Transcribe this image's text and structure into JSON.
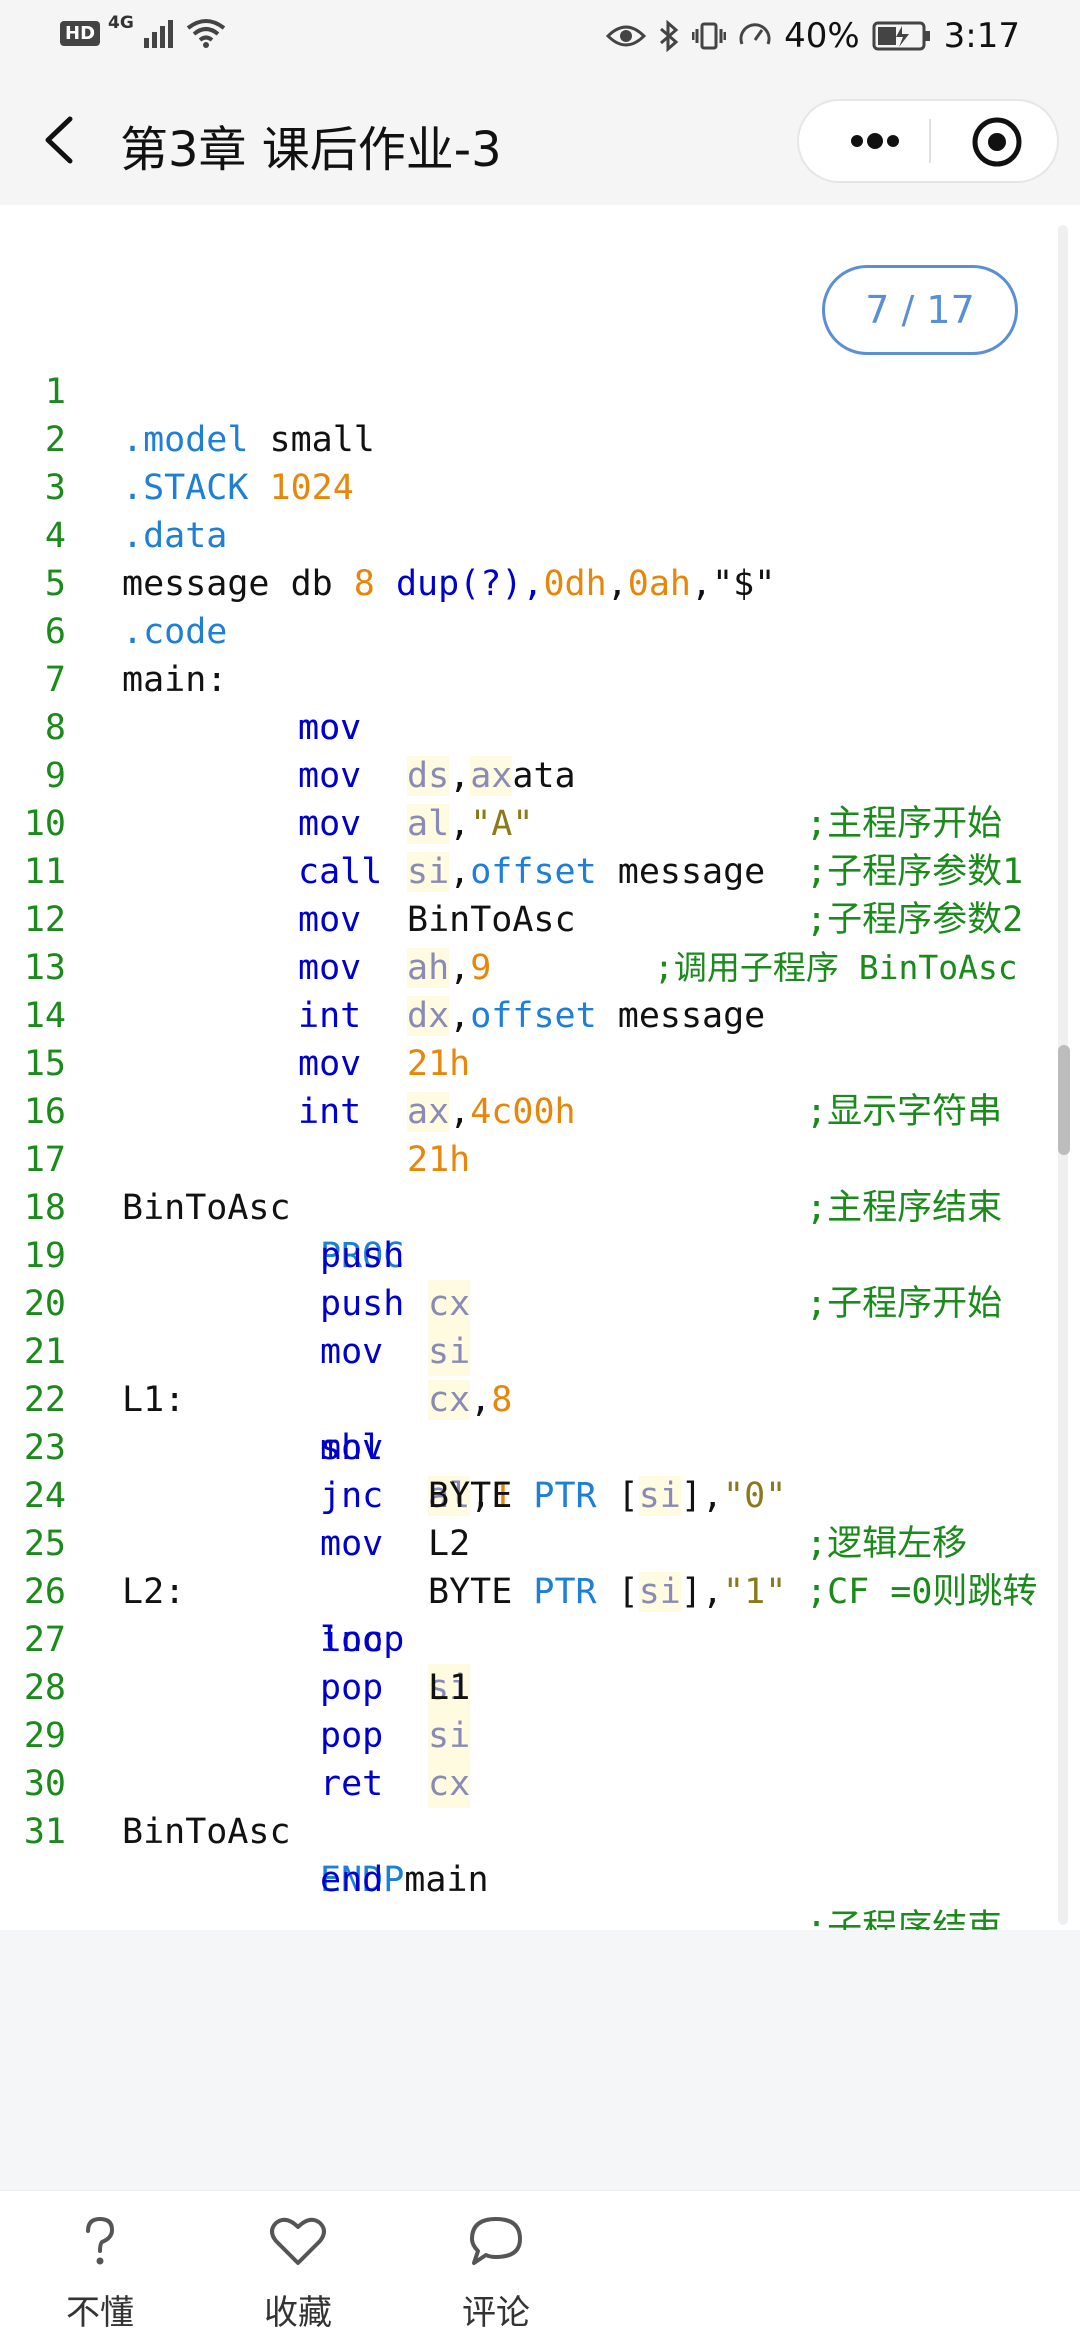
{
  "status_bar": {
    "hd": "HD",
    "network": "4G",
    "battery_percent": "40%",
    "time": "3:17"
  },
  "header": {
    "title": "第3章 课后作业-3"
  },
  "pager": {
    "text": "7 / 17"
  },
  "code_lines": [
    {
      "n": "1"
    },
    {
      "n": "2"
    },
    {
      "n": "3"
    },
    {
      "n": "4"
    },
    {
      "n": "5"
    },
    {
      "n": "6"
    },
    {
      "n": "7"
    },
    {
      "n": "8"
    },
    {
      "n": "9"
    },
    {
      "n": "10"
    },
    {
      "n": "11"
    },
    {
      "n": "12"
    },
    {
      "n": "13"
    },
    {
      "n": "14"
    },
    {
      "n": "15"
    },
    {
      "n": "16"
    },
    {
      "n": "17"
    },
    {
      "n": "18"
    },
    {
      "n": "19"
    },
    {
      "n": "20"
    },
    {
      "n": "21"
    },
    {
      "n": "22"
    },
    {
      "n": "23"
    },
    {
      "n": "24"
    },
    {
      "n": "25"
    },
    {
      "n": "26"
    },
    {
      "n": "27"
    },
    {
      "n": "28"
    },
    {
      "n": "29"
    },
    {
      "n": "30"
    },
    {
      "n": "31"
    }
  ],
  "code": {
    "l1": [
      ".model",
      " small"
    ],
    "l2": [
      ".STACK",
      " 1024"
    ],
    "l3": [
      ".data"
    ],
    "l4": [
      "message db ",
      "8",
      " ",
      "dup",
      "(?),",
      "0dh",
      ",",
      "0ah",
      ",",
      "\"$\""
    ],
    "l5": [
      ".code"
    ],
    "l6": [
      "main:",
      "mov",
      "ax",
      ",@data",
      ";主程序开始"
    ],
    "l7": [
      "mov",
      "ds",
      ",",
      "ax"
    ],
    "l8": [
      "mov",
      "al",
      ",",
      "\"A\"",
      ";子程序参数1"
    ],
    "l9": [
      "mov",
      "si",
      ",",
      "offset",
      " message",
      ";子程序参数2"
    ],
    "l10": [
      "call",
      "BinToAsc",
      ";调用子程序 BinToAsc"
    ],
    "l11": [
      "mov",
      "ah",
      ",",
      "9"
    ],
    "l12": [
      "mov",
      "dx",
      ",",
      "offset",
      " message"
    ],
    "l13": [
      "int",
      "21h",
      ";显示字符串"
    ],
    "l14": [
      "mov",
      "ax",
      ",",
      "4c00h"
    ],
    "l15": [
      "int",
      "21h",
      ";主程序结束"
    ],
    "l17": [
      "BinToAsc",
      "PROC",
      ";子程序开始"
    ],
    "l18": [
      "push",
      "cx"
    ],
    "l19": [
      "push",
      "si"
    ],
    "l20": [
      "mov",
      "cx",
      ",",
      "8"
    ],
    "l21": [
      "L1:",
      "shl",
      "al",
      ",",
      "1",
      ";逻辑左移"
    ],
    "l22": [
      "mov",
      "BYTE",
      " PTR ",
      "[",
      "si",
      "],",
      "\"0\""
    ],
    "l23": [
      "jnc",
      "L2",
      ";CF =0则跳转"
    ],
    "l24": [
      "mov",
      "BYTE",
      " PTR ",
      "[",
      "si",
      "],",
      "\"1\""
    ],
    "l25": [
      "L2:",
      "inc",
      "si"
    ],
    "l26": [
      "loop",
      "L1"
    ],
    "l27": [
      "pop",
      "si"
    ],
    "l28": [
      "pop",
      "cx"
    ],
    "l29": [
      "ret"
    ],
    "l30": [
      "BinToAsc",
      "ENDP",
      ";子程序结束"
    ],
    "l31": [
      "end",
      " main"
    ]
  },
  "bottom_bar": {
    "items": [
      {
        "label": "不懂",
        "icon": "question-icon"
      },
      {
        "label": "收藏",
        "icon": "heart-icon"
      },
      {
        "label": "评论",
        "icon": "comment-icon"
      }
    ]
  },
  "colors": {
    "line_number": "#1a8a1a",
    "keyword": "#0000cc",
    "directive": "#1e7fd6",
    "number": "#e8860a",
    "register": "#8a8ab8",
    "string": "#8a7a1a",
    "comment": "#1a8a1a",
    "pager_border": "#5a8fd6"
  }
}
